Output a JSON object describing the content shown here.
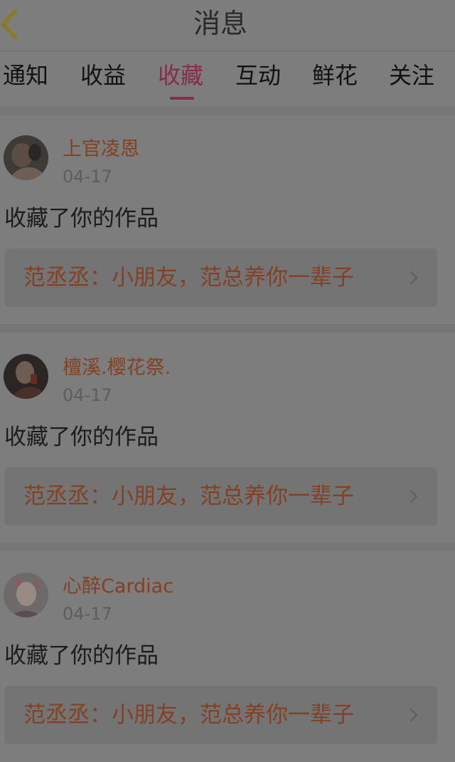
{
  "header": {
    "title": "消息"
  },
  "tabs": [
    {
      "label": "通知"
    },
    {
      "label": "收益"
    },
    {
      "label": "收藏",
      "active": true
    },
    {
      "label": "互动"
    },
    {
      "label": "鲜花"
    },
    {
      "label": "关注"
    }
  ],
  "items": [
    {
      "username": "上官凌恩",
      "date": "04-17",
      "action": "收藏了你的作品",
      "work_title": "范丞丞：小朋友，范总养你一辈子"
    },
    {
      "username": "檀溪.樱花祭.",
      "date": "04-17",
      "action": "收藏了你的作品",
      "work_title": "范丞丞：小朋友，范总养你一辈子"
    },
    {
      "username": "心醉Cardiac",
      "date": "04-17",
      "action": "收藏了你的作品",
      "work_title": "范丞丞：小朋友，范总养你一辈子"
    }
  ],
  "colors": {
    "overlay_background": "#7d7d7d",
    "active_tab": "#8a2a4c",
    "username": "#844022",
    "back_icon": "#8c7a1c"
  },
  "icons": {
    "back": "chevron-left-icon",
    "item_arrow": "chevron-right-icon"
  }
}
